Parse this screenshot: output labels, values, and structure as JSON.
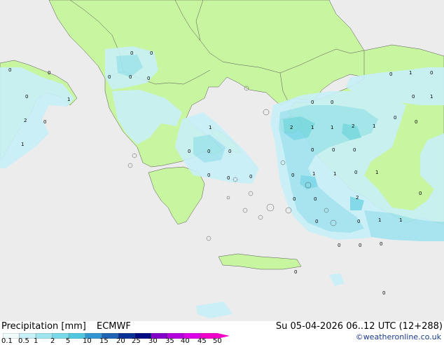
{
  "title_left": "Precipitation [mm]",
  "model": "ECMWF",
  "valid_time": "Su 05-04-2026 06..12 UTC (12+288)",
  "credit": "©weatheronline.co.uk",
  "legend": {
    "labels": [
      "0.1",
      "0.5",
      "1",
      "2",
      "5",
      "10",
      "15",
      "20",
      "25",
      "30",
      "35",
      "40",
      "45",
      "50"
    ],
    "colors": [
      "#f0fcfc",
      "#c8f0f8",
      "#a0e4f0",
      "#78d8e8",
      "#50c8e0",
      "#3296d2",
      "#1e64b4",
      "#0a3296",
      "#000a82",
      "#8200c8",
      "#b400dc",
      "#dc00e6",
      "#f000c8"
    ]
  },
  "colors": {
    "sea": "#ececec",
    "land": "#c8f5a0",
    "light_precip": "#c8f0f8",
    "medium_precip": "#a0e4f0",
    "strong_precip": "#78d8e8"
  },
  "map_values": [
    "0",
    "0",
    "0",
    "0",
    "0",
    "0",
    "0",
    "0",
    "1",
    "2",
    "0",
    "1",
    "0",
    "0",
    "0",
    "1",
    "0",
    "0",
    "0",
    "0",
    "0",
    "1",
    "1",
    "0",
    "0",
    "0",
    "2",
    "1",
    "1",
    "2",
    "1",
    "0",
    "0",
    "0",
    "0",
    "0",
    "0",
    "1",
    "1",
    "0",
    "1",
    "0",
    "0",
    "2",
    "0",
    "0",
    "1",
    "1",
    "0",
    "0",
    "0",
    "0",
    "0",
    "0"
  ]
}
